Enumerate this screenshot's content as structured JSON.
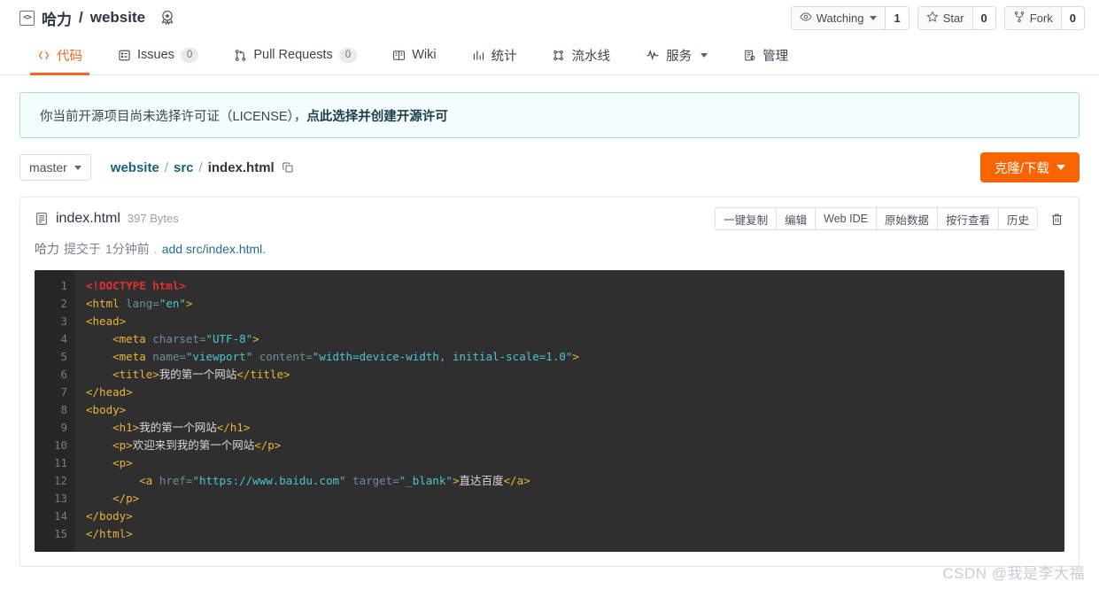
{
  "header": {
    "repo_icon": "code-brackets-icon",
    "owner": "哈力",
    "separator": "/",
    "repo_name": "website",
    "badge_icon": "award-badge-icon",
    "watch": {
      "icon": "eye-icon",
      "label": "Watching",
      "count": "1"
    },
    "star": {
      "icon": "star-icon",
      "label": "Star",
      "count": "0"
    },
    "fork": {
      "icon": "fork-icon",
      "label": "Fork",
      "count": "0"
    }
  },
  "nav": {
    "tabs": [
      {
        "label": "代码",
        "icon": "code-icon",
        "count": null,
        "active": true
      },
      {
        "label": "Issues",
        "icon": "issues-icon",
        "count": "0",
        "active": false
      },
      {
        "label": "Pull Requests",
        "icon": "pull-request-icon",
        "count": "0",
        "active": false
      },
      {
        "label": "Wiki",
        "icon": "book-icon",
        "count": null,
        "active": false
      },
      {
        "label": "统计",
        "icon": "chart-icon",
        "count": null,
        "active": false
      },
      {
        "label": "流水线",
        "icon": "pipeline-icon",
        "count": null,
        "active": false
      },
      {
        "label": "服务",
        "icon": "activity-icon",
        "count": null,
        "active": false,
        "has_caret": true
      },
      {
        "label": "管理",
        "icon": "settings-list-icon",
        "count": null,
        "active": false
      }
    ]
  },
  "license_banner": {
    "text": "你当前开源项目尚未选择许可证（LICENSE），",
    "link": "点此选择并创建开源许可"
  },
  "branch_row": {
    "branch": "master",
    "branch_caret_icon": "chevron-down-icon",
    "breadcrumb": [
      {
        "label": "website",
        "last": false
      },
      {
        "label": "src",
        "last": false
      },
      {
        "label": "index.html",
        "last": true
      }
    ],
    "separator": "/",
    "copy_path_icon": "copy-icon",
    "clone_button": "克隆/下载"
  },
  "file": {
    "doc_icon": "file-text-icon",
    "name": "index.html",
    "size": "397 Bytes",
    "actions": [
      "一键复制",
      "编辑",
      "Web IDE",
      "原始数据",
      "按行查看",
      "历史"
    ],
    "delete_icon": "trash-icon",
    "commit": {
      "author": "哈力",
      "verb": "提交于",
      "time": "1分钟前",
      "dot": ".",
      "message": "add src/index.html."
    }
  },
  "code": {
    "line_numbers": [
      "1",
      "2",
      "3",
      "4",
      "5",
      "6",
      "7",
      "8",
      "9",
      "10",
      "11",
      "12",
      "13",
      "14",
      "15"
    ],
    "lines": [
      [
        {
          "t": "doc",
          "v": "<!DOCTYPE html>"
        }
      ],
      [
        {
          "t": "tag",
          "v": "<html "
        },
        {
          "t": "attr",
          "v": "lang="
        },
        {
          "t": "val",
          "v": "\"en\""
        },
        {
          "t": "tag",
          "v": ">"
        }
      ],
      [
        {
          "t": "tag",
          "v": "<head>"
        }
      ],
      [
        {
          "t": "txt",
          "v": "    "
        },
        {
          "t": "tag",
          "v": "<meta "
        },
        {
          "t": "attr",
          "v": "charset="
        },
        {
          "t": "val",
          "v": "\"UTF-8\""
        },
        {
          "t": "tag",
          "v": ">"
        }
      ],
      [
        {
          "t": "txt",
          "v": "    "
        },
        {
          "t": "tag",
          "v": "<meta "
        },
        {
          "t": "attr",
          "v": "name="
        },
        {
          "t": "val",
          "v": "\"viewport\""
        },
        {
          "t": "attr",
          "v": " content="
        },
        {
          "t": "val",
          "v": "\"width=device-width, initial-scale=1.0\""
        },
        {
          "t": "tag",
          "v": ">"
        }
      ],
      [
        {
          "t": "txt",
          "v": "    "
        },
        {
          "t": "tag",
          "v": "<title>"
        },
        {
          "t": "txt",
          "v": "我的第一个网站"
        },
        {
          "t": "tag",
          "v": "</title>"
        }
      ],
      [
        {
          "t": "tag",
          "v": "</head>"
        }
      ],
      [
        {
          "t": "tag",
          "v": "<body>"
        }
      ],
      [
        {
          "t": "txt",
          "v": "    "
        },
        {
          "t": "tag",
          "v": "<h1>"
        },
        {
          "t": "txt",
          "v": "我的第一个网站"
        },
        {
          "t": "tag",
          "v": "</h1>"
        }
      ],
      [
        {
          "t": "txt",
          "v": "    "
        },
        {
          "t": "tag",
          "v": "<p>"
        },
        {
          "t": "txt",
          "v": "欢迎来到我的第一个网站"
        },
        {
          "t": "tag",
          "v": "</p>"
        }
      ],
      [
        {
          "t": "txt",
          "v": "    "
        },
        {
          "t": "tag",
          "v": "<p>"
        }
      ],
      [
        {
          "t": "txt",
          "v": "        "
        },
        {
          "t": "tag",
          "v": "<a "
        },
        {
          "t": "attr",
          "v": "href="
        },
        {
          "t": "val",
          "v": "\"https://www.baidu.com\""
        },
        {
          "t": "attr",
          "v": " target="
        },
        {
          "t": "val",
          "v": "\"_blank\""
        },
        {
          "t": "tag",
          "v": ">"
        },
        {
          "t": "txt",
          "v": "直达百度"
        },
        {
          "t": "tag",
          "v": "</a>"
        }
      ],
      [
        {
          "t": "txt",
          "v": "    "
        },
        {
          "t": "tag",
          "v": "</p>"
        }
      ],
      [
        {
          "t": "tag",
          "v": "</body>"
        }
      ],
      [
        {
          "t": "tag",
          "v": "</html>"
        }
      ]
    ]
  },
  "watermark": "CSDN @我是李大福",
  "colors": {
    "accent": "#f26722",
    "clone_button": "#fa6400",
    "link": "#1f6f8b",
    "banner_bg": "#f4fcfd",
    "banner_border": "#a9dbe4",
    "code_bg": "#2f2f2f",
    "gutter_bg": "#272727",
    "tag": "#e8b339",
    "attr": "#6b8f93",
    "value": "#4ec3cf",
    "doctype": "#e03131"
  }
}
